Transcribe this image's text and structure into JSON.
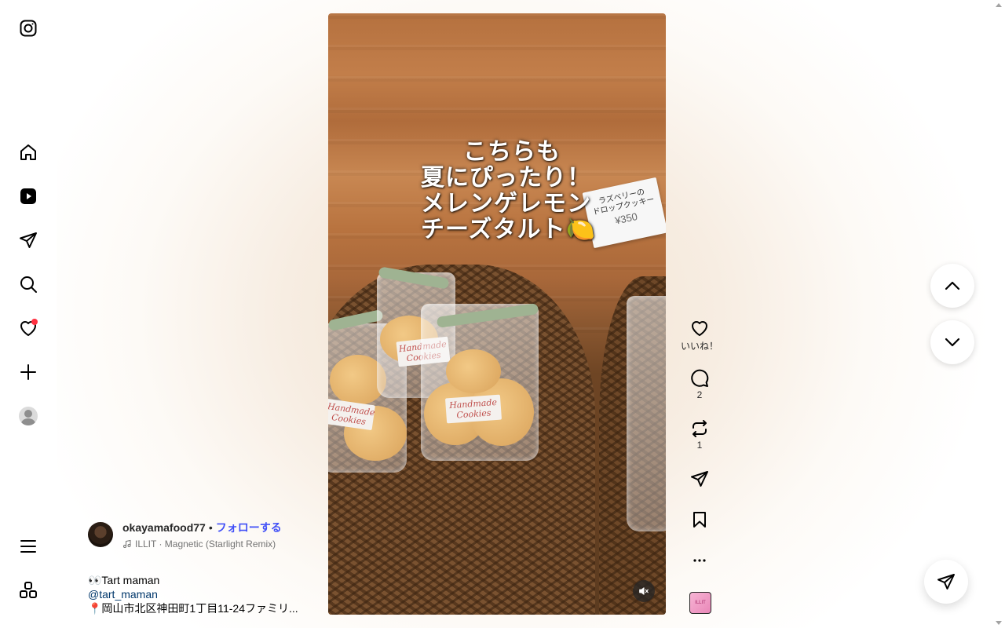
{
  "nav": {
    "items": [
      {
        "name": "instagram-logo-icon"
      },
      {
        "name": "home-icon"
      },
      {
        "name": "reels-icon"
      },
      {
        "name": "messages-icon"
      },
      {
        "name": "search-icon"
      },
      {
        "name": "notifications-icon",
        "has_badge": true
      },
      {
        "name": "create-icon"
      },
      {
        "name": "profile-icon"
      },
      {
        "name": "more-menu-icon"
      },
      {
        "name": "also-from-meta-icon"
      }
    ]
  },
  "reel": {
    "overlay_lines": [
      "こちらも",
      "夏にぴったり！",
      "メレンゲレモン",
      "チーズタルト🍋"
    ],
    "cookie_label_lines": [
      "Handmade",
      "Cookies"
    ],
    "price_card_lines": [
      "ラズベリーの",
      "ドロップクッキー",
      "¥350"
    ],
    "mute_icon": "speaker-muted-icon"
  },
  "actions": {
    "like_label": "いいね！",
    "comment_count": "2",
    "repost_count": "1",
    "audio_thumb_text": "ILLIT"
  },
  "caption": {
    "username": "okayamafood77",
    "separator": "•",
    "follow_label": "フォローする",
    "music": "ILLIT · Magnetic (Starlight Remix)",
    "line1": "👀Tart maman",
    "mention": "@tart_maman",
    "location": "📍岡山市北区神田町1丁目11-24ファミリ..."
  },
  "colors": {
    "accent_link": "#4150f7",
    "notification_badge": "#ff3040",
    "mention": "#00376b"
  }
}
